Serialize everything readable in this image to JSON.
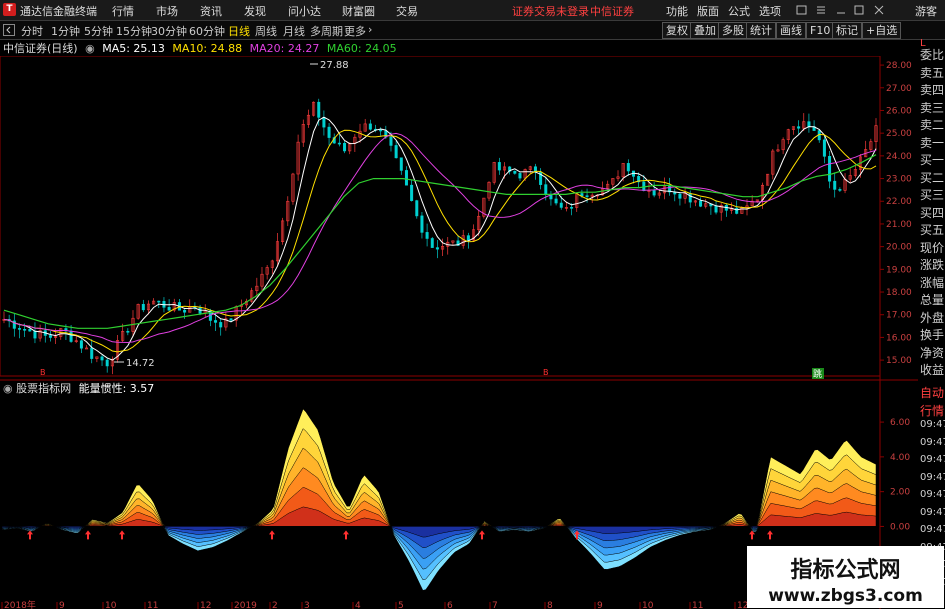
{
  "menubar": {
    "app_name": "通达信金融终端",
    "menus": [
      "行情",
      "市场",
      "资讯",
      "发现",
      "问小达",
      "财富圈",
      "交易"
    ],
    "warning": "证券交易未登录",
    "broker": "中信证券",
    "tools": [
      "功能",
      "版面",
      "公式",
      "选项"
    ],
    "guest": "游客"
  },
  "periodbar": {
    "periods": [
      "分时",
      "1分钟",
      "5分钟",
      "15分钟",
      "30分钟",
      "60分钟",
      "日线",
      "周线",
      "月线",
      "多周期",
      "更多"
    ],
    "active": "日线",
    "tools": [
      "复权",
      "叠加",
      "多股",
      "统计",
      "画线",
      "F10",
      "标记",
      "+自选"
    ]
  },
  "info": {
    "title": "中信证券(日线)",
    "ma5": "MA5: 25.13",
    "ma10": "MA10: 24.88",
    "ma20": "MA20: 24.27",
    "ma60": "MA60: 24.05",
    "ma5_color": "#ffffff",
    "ma10_color": "#ffe000",
    "ma20_color": "#e040e0",
    "ma60_color": "#30d030"
  },
  "annotations": {
    "high": "27.88",
    "low": "14.72",
    "jump_tag": "跳"
  },
  "lower": {
    "name": "股票指标网",
    "indicator": "能量惯性: 3.57"
  },
  "right_panel": {
    "upper": [
      "L",
      "委比",
      "卖五",
      "卖四",
      "卖三",
      "卖二",
      "卖一",
      "买一",
      "买二",
      "买三",
      "买四",
      "买五",
      "现价",
      "涨跌",
      "涨幅",
      "总量",
      "外盘",
      "换手",
      "净资",
      "收益"
    ],
    "lower": [
      "自动",
      "行情",
      "09:47",
      "09:47",
      "09:47",
      "09:47",
      "09:47",
      "09:47",
      "09:47",
      "09:47",
      "09:47",
      "09:47"
    ]
  },
  "watermark": {
    "line1": "指标公式网",
    "line2": "www.zbgs3.com"
  },
  "chart_data": [
    {
      "type": "candlestick",
      "title": "中信证券(日线)",
      "y_ticks": [
        "28.00",
        "27.00",
        "26.00",
        "25.00",
        "24.00",
        "23.00",
        "22.00",
        "21.00",
        "20.00",
        "19.00",
        "18.00",
        "17.00",
        "16.00",
        "15.00"
      ],
      "ylim": [
        14.3,
        28.4
      ],
      "x_ticks": [
        "2018年",
        "9",
        "10",
        "11",
        "12",
        "2019",
        "2",
        "3",
        "4",
        "5",
        "6",
        "7",
        "8",
        "9",
        "10",
        "11",
        "12"
      ],
      "close_approx": [
        16.8,
        16.5,
        16.2,
        16.0,
        16.3,
        15.8,
        15.2,
        14.9,
        16.0,
        17.2,
        17.6,
        17.4,
        17.2,
        17.4,
        16.8,
        16.6,
        17.4,
        18.2,
        19.2,
        21.5,
        25.0,
        26.2,
        24.8,
        24.2,
        25.2,
        25.4,
        24.5,
        23.0,
        21.2,
        20.0,
        20.1,
        20.2,
        21.0,
        23.5,
        23.3,
        23.2,
        23.4,
        22.0,
        21.5,
        22.4,
        22.5,
        22.6,
        23.8,
        22.8,
        22.4,
        22.6,
        22.3,
        22.0,
        21.8,
        21.6,
        21.5,
        22.2,
        24.0,
        25.3,
        25.5,
        25.1,
        22.5,
        22.8,
        23.8,
        25.1
      ],
      "ma60_approx": [
        17.2,
        17.0,
        16.8,
        16.6,
        16.5,
        16.4,
        16.4,
        16.4,
        16.5,
        16.6,
        16.7,
        16.8,
        16.9,
        17.0,
        17.1,
        17.2,
        17.4,
        17.8,
        18.3,
        19.0,
        19.8,
        20.6,
        21.4,
        22.2,
        22.8,
        23.0,
        23.0,
        23.0,
        22.9,
        22.8,
        22.7,
        22.6,
        22.5,
        22.4,
        22.3,
        22.3,
        22.3,
        22.3,
        22.3,
        22.4,
        22.4,
        22.5,
        22.6,
        22.6,
        22.7,
        22.7,
        22.6,
        22.5,
        22.4,
        22.3,
        22.2,
        22.2,
        22.4,
        22.6,
        22.9,
        23.1,
        23.2,
        23.4,
        23.7,
        24.05
      ]
    },
    {
      "type": "area",
      "title": "能量惯性",
      "value": 3.57,
      "y_ticks": [
        "6.00",
        "4.00",
        "2.00",
        "0.00"
      ],
      "ylim": [
        -4.0,
        7.5
      ],
      "values_approx": [
        -0.2,
        -0.1,
        -0.3,
        0.2,
        -0.2,
        -0.4,
        0.4,
        0.2,
        0.8,
        2.5,
        1.5,
        -0.5,
        -1.0,
        -1.4,
        -1.2,
        -0.8,
        -0.3,
        0.2,
        1.0,
        4.5,
        6.8,
        5.5,
        2.5,
        1.0,
        3.0,
        2.0,
        -0.5,
        -2.0,
        -3.8,
        -2.5,
        -1.5,
        -1.0,
        0.3,
        -0.3,
        -0.2,
        -0.3,
        -0.1,
        0.5,
        -0.6,
        -1.5,
        -2.5,
        -2.3,
        -1.8,
        -1.2,
        -0.8,
        -0.5,
        -0.3,
        -0.2,
        0.2,
        0.8,
        -0.5,
        4.0,
        3.5,
        3.0,
        4.5,
        3.8,
        5.0,
        4.0,
        3.57
      ]
    }
  ]
}
